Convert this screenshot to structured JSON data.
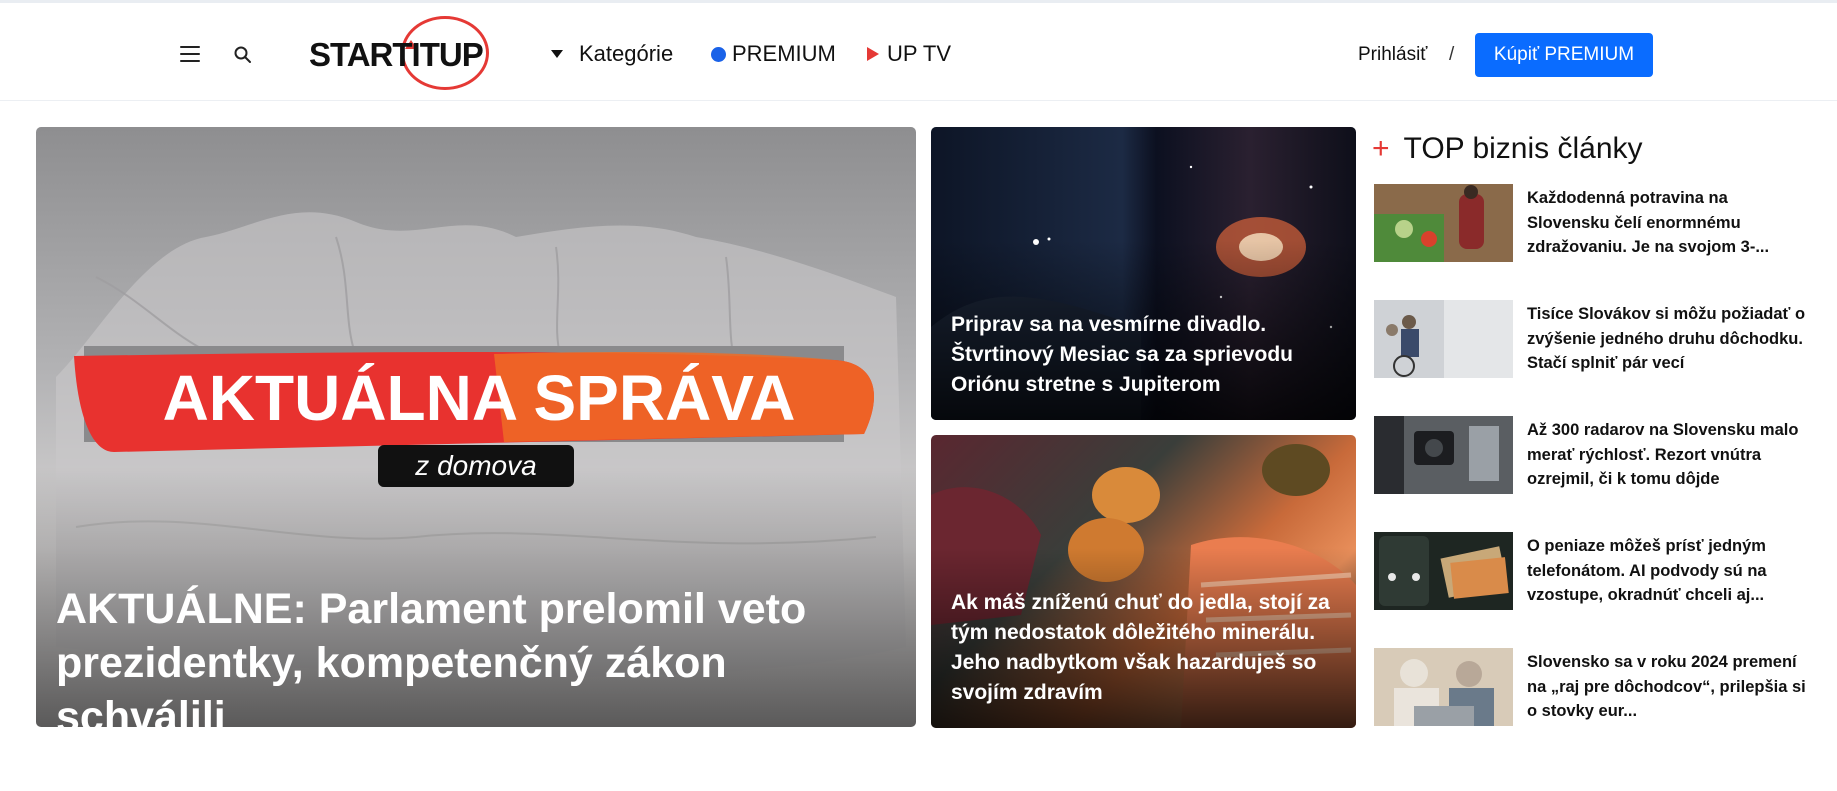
{
  "header": {
    "logo_text": "STARTITUP",
    "nav": {
      "categories": "Kategórie",
      "premium": "PREMIUM",
      "uptv": "UP TV"
    },
    "login": "Prihlásiť",
    "separator": "/",
    "buy_premium": "Kúpiť PREMIUM"
  },
  "colors": {
    "accent_red": "#e53935",
    "accent_blue": "#0a6cff"
  },
  "icons": {
    "menu": "hamburger-icon",
    "search": "search-icon",
    "categories": "caret-down-icon",
    "premium": "blue-dot-icon",
    "uptv": "play-icon"
  },
  "hero": {
    "banner_text": "AKTUÁLNA SPRÁVA",
    "banner_tagline": "z domova",
    "title": "AKTUÁLNE: Parlament prelomil veto prezidentky, kompetenčný zákon schválili"
  },
  "cards": [
    {
      "title": "Priprav sa na vesmírne divadlo. Štvrtinový Mesiac sa za sprievodu Oriónu stretne s Jupiterom"
    },
    {
      "title": "Ak máš zníženú chuť do jedla, stojí za tým nedostatok dôležitého minerálu. Jeho nadbytkom však hazarduješ so svojím zdravím"
    }
  ],
  "top_articles": {
    "heading": "TOP biznis články",
    "items": [
      {
        "title": "Každodenná potravina na Slovensku čelí enormnému zdražovaniu. Je na svojom 3-..."
      },
      {
        "title": "Tisíce Slovákov si môžu požiadať o zvýšenie jedného druhu dôchodku. Stačí splniť pár vecí"
      },
      {
        "title": "Až 300 radarov na Slovensku malo merať rýchlosť. Rezort vnútra ozrejmil, či k tomu dôjde"
      },
      {
        "title": "O peniaze môžeš prísť jedným telefonátom. AI podvody sú na vzostupe, okradnúť chceli aj..."
      },
      {
        "title": "Slovensko sa v roku 2024 premení na „raj pre dôchodcov“, prilepšia si o stovky eur..."
      }
    ]
  }
}
